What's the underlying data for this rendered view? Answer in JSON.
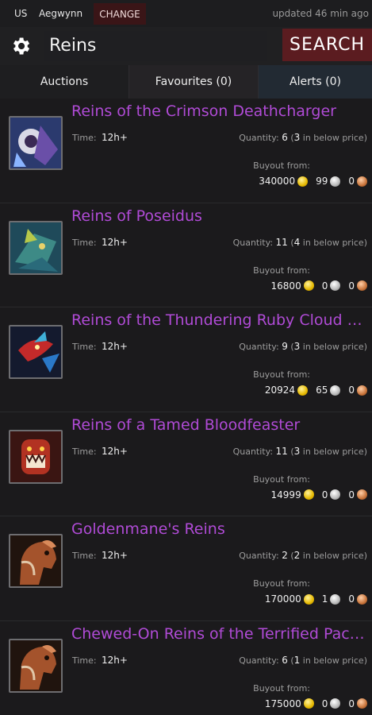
{
  "topbar": {
    "region": "US",
    "realm": "Aegwynn",
    "change_label": "CHANGE",
    "updated": "updated 46 min ago"
  },
  "search": {
    "query": "Reins",
    "button_label": "SEARCH"
  },
  "tabs": [
    {
      "label": "Auctions",
      "selected": true
    },
    {
      "label": "Favourites (0)",
      "selected": false
    },
    {
      "label": "Alerts (0)",
      "selected": false
    }
  ],
  "labels": {
    "time": "Time:",
    "quantity": "Quantity:",
    "in_below_price": "in below price",
    "buyout_from": "Buyout from:"
  },
  "items": [
    {
      "name": "Reins of the Crimson Deathcharger",
      "time": "12h+",
      "quantity": "6",
      "below": "3",
      "gold": "340000",
      "silver": "99",
      "copper": "0",
      "icon": "crimson-deathcharger-icon"
    },
    {
      "name": "Reins of Poseidus",
      "time": "12h+",
      "quantity": "11",
      "below": "4",
      "gold": "16800",
      "silver": "0",
      "copper": "0",
      "icon": "poseidus-icon"
    },
    {
      "name": "Reins of the Thundering Ruby Cloud Ser...",
      "time": "12h+",
      "quantity": "9",
      "below": "3",
      "gold": "20924",
      "silver": "65",
      "copper": "0",
      "icon": "ruby-cloud-serpent-icon"
    },
    {
      "name": "Reins of a Tamed Bloodfeaster",
      "time": "12h+",
      "quantity": "11",
      "below": "3",
      "gold": "14999",
      "silver": "0",
      "copper": "0",
      "icon": "bloodfeaster-icon"
    },
    {
      "name": "Goldenmane's Reins",
      "time": "12h+",
      "quantity": "2",
      "below": "2",
      "gold": "170000",
      "silver": "1",
      "copper": "0",
      "icon": "horse-icon"
    },
    {
      "name": "Chewed-On Reins of the Terrified Pack...",
      "time": "12h+",
      "quantity": "6",
      "below": "1",
      "gold": "175000",
      "silver": "0",
      "copper": "0",
      "icon": "horse-icon"
    }
  ],
  "colors": {
    "item_name": "#b04bd6",
    "search_button": "#5b1c20",
    "change_button": "#3a1517",
    "alerts_tab": "#222a33"
  }
}
